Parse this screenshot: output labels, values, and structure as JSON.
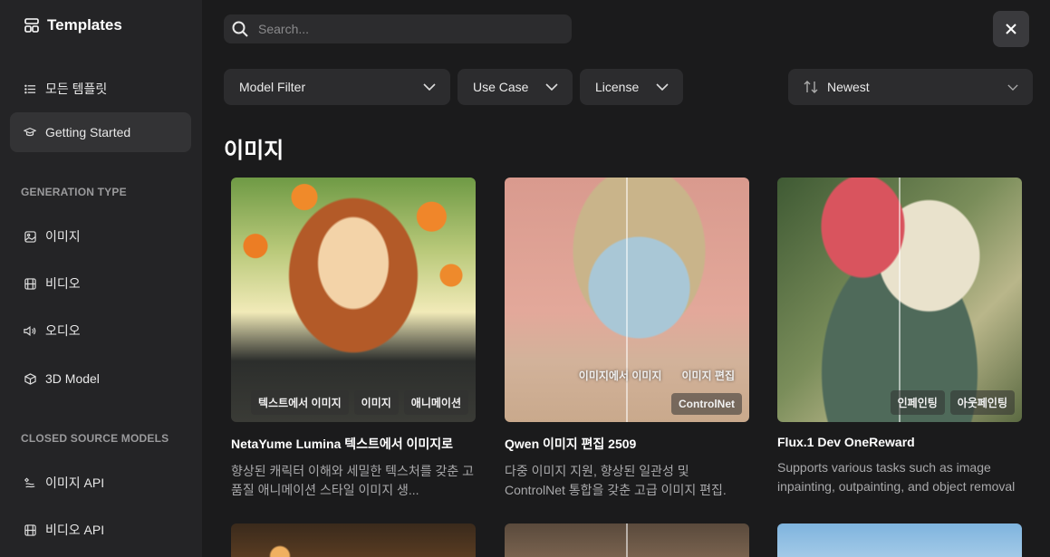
{
  "app": {
    "title": "Templates"
  },
  "sidebar": {
    "items": [
      {
        "label": "모든 템플릿",
        "icon": "list-icon"
      },
      {
        "label": "Getting Started",
        "icon": "graduation-cap-icon",
        "active": true
      }
    ],
    "sections": [
      {
        "label": "GENERATION TYPE",
        "items": [
          {
            "label": "이미지",
            "icon": "image-icon"
          },
          {
            "label": "비디오",
            "icon": "film-icon"
          },
          {
            "label": "오디오",
            "icon": "speaker-icon"
          },
          {
            "label": "3D Model",
            "icon": "cube-icon"
          }
        ]
      },
      {
        "label": "CLOSED SOURCE MODELS",
        "items": [
          {
            "label": "이미지 API",
            "icon": "sparkle-image-icon"
          },
          {
            "label": "비디오 API",
            "icon": "film-icon"
          }
        ]
      }
    ]
  },
  "search": {
    "placeholder": "Search..."
  },
  "filters": {
    "model": "Model Filter",
    "use_case": "Use Case",
    "license": "License",
    "sort": "Newest"
  },
  "section_title": "이미지",
  "cards": [
    {
      "title": "NetaYume Lumina 텍스트에서 이미지로",
      "description": "향상된 캐릭터 이해와 세밀한 텍스처를 갖춘 고품질 애니메이션 스타일 이미지 생...",
      "tags": [
        "텍스트에서 이미지",
        "이미지",
        "애니메이션"
      ]
    },
    {
      "title": "Qwen 이미지 편집 2509",
      "description": "다중 이미지 지원, 향상된 일관성 및 ControlNet 통합을 갖춘 고급 이미지 편집.",
      "tags_row1": [
        "이미지에서 이미지",
        "이미지 편집"
      ],
      "tags": [
        "ControlNet"
      ]
    },
    {
      "title": "Flux.1 Dev OneReward",
      "description": "Supports various tasks such as image inpainting, outpainting, and object removal",
      "tags": [
        "인페인팅",
        "아웃페인팅"
      ]
    }
  ],
  "colors": {
    "sidebar_bg": "#242426",
    "main_bg": "#1b1b1c",
    "control_bg": "#2c2c2e",
    "active_bg": "#333335"
  }
}
